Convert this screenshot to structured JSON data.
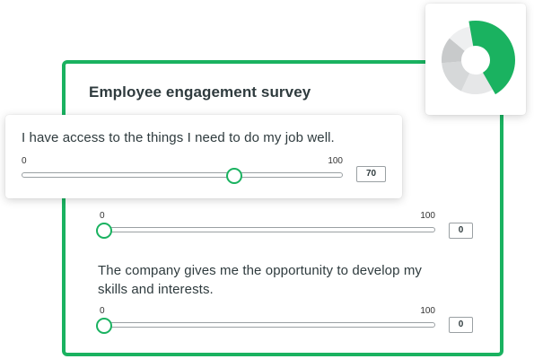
{
  "survey": {
    "title": "Employee engagement survey",
    "accent_color": "#1ab260"
  },
  "questions": [
    {
      "text": "I have access to the things I need to do my job well.",
      "min_label": "0",
      "max_label": "100",
      "value": "70",
      "slider_fraction": 0.66
    },
    {
      "text": "",
      "min_label": "0",
      "max_label": "100",
      "value": "0",
      "slider_fraction": 0
    },
    {
      "text": "The company gives me the opportunity to develop my skills and interests.",
      "min_label": "0",
      "max_label": "100",
      "value": "0",
      "slider_fraction": 0
    }
  ],
  "chart_card": {
    "icon": "donut-chart-icon",
    "colors": [
      "#1ab260",
      "#e6e7e8",
      "#d6d8d9",
      "#c8cacb",
      "#eeeff0"
    ]
  }
}
